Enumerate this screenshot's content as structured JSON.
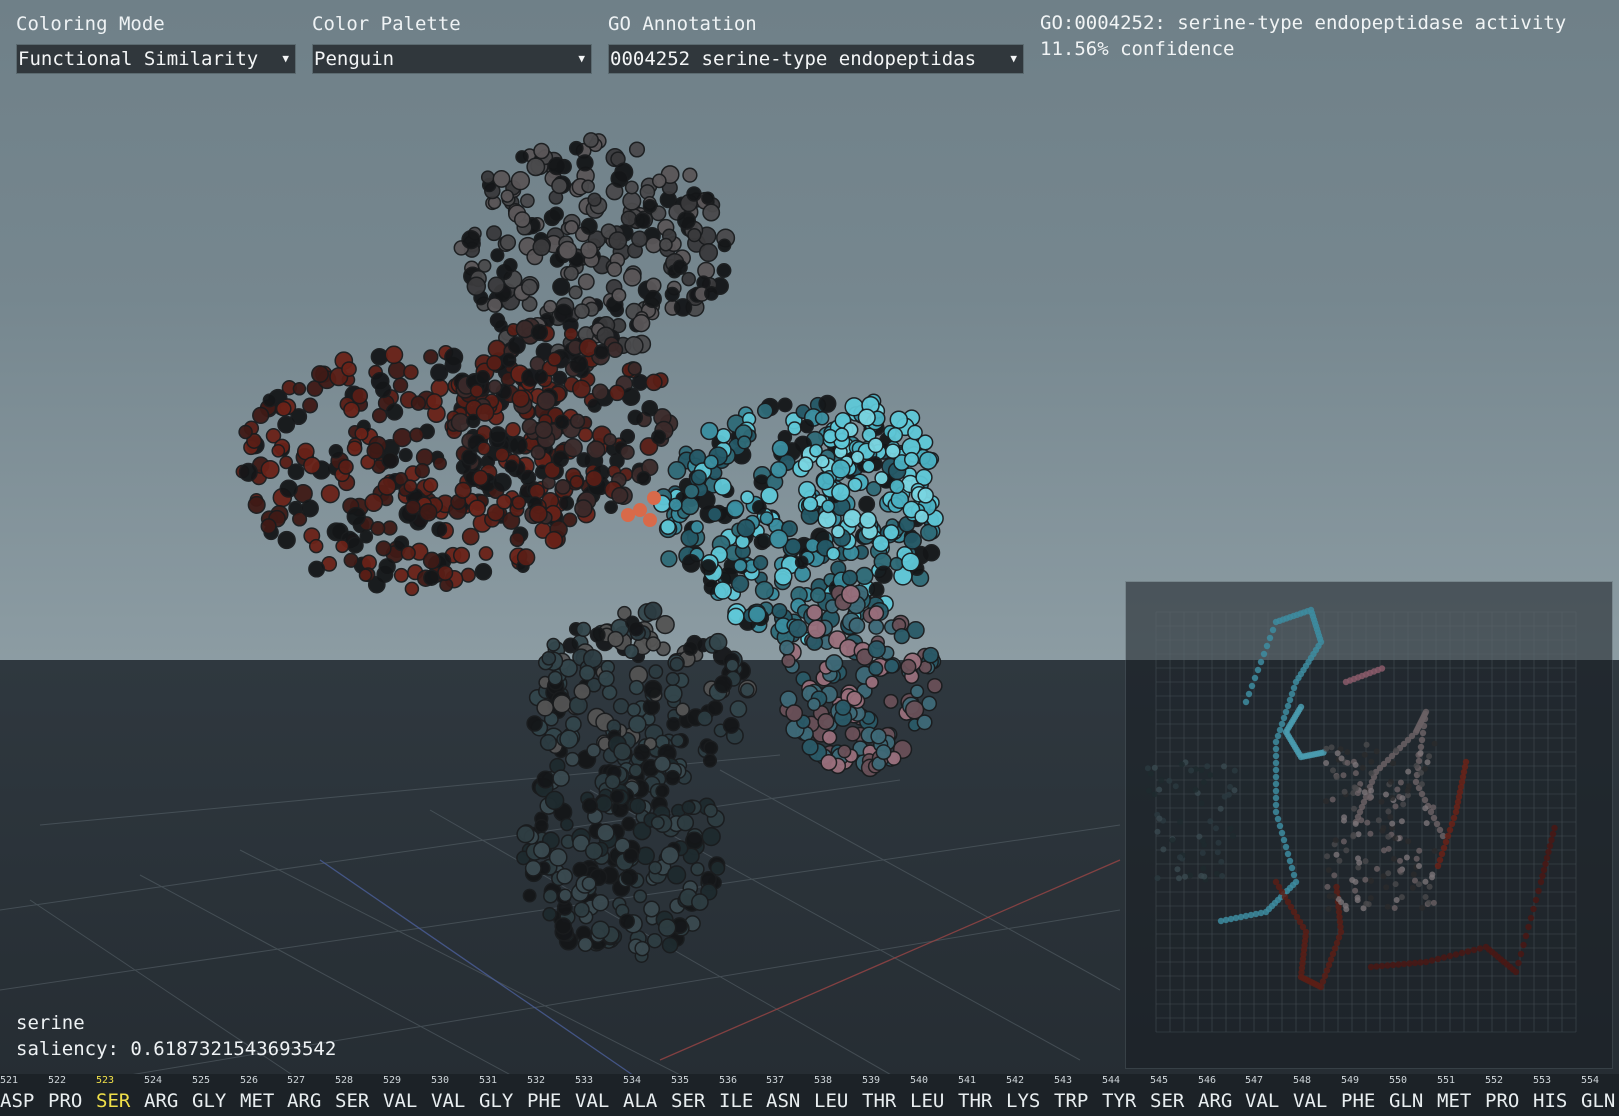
{
  "controls": {
    "coloring_mode": {
      "label": "Coloring Mode",
      "value": "Functional Similarity"
    },
    "color_palette": {
      "label": "Color Palette",
      "value": "Penguin"
    },
    "go_annotation": {
      "label": "GO Annotation",
      "value": "0004252 serine-type endopeptidas"
    }
  },
  "go_info": {
    "term": "GO:0004252: serine-type endopeptidase activity",
    "confidence": "11.56% confidence"
  },
  "hover": {
    "residue": "serine",
    "saliency": "saliency: 0.6187321543693542"
  },
  "sequence": {
    "highlight_index": 2,
    "highlight_color": "#f0e04a",
    "residues": [
      {
        "num": "521",
        "code": "ASP"
      },
      {
        "num": "522",
        "code": "PRO"
      },
      {
        "num": "523",
        "code": "SER"
      },
      {
        "num": "524",
        "code": "ARG"
      },
      {
        "num": "525",
        "code": "GLY"
      },
      {
        "num": "526",
        "code": "MET"
      },
      {
        "num": "527",
        "code": "ARG"
      },
      {
        "num": "528",
        "code": "SER"
      },
      {
        "num": "529",
        "code": "VAL"
      },
      {
        "num": "530",
        "code": "VAL"
      },
      {
        "num": "531",
        "code": "GLY"
      },
      {
        "num": "532",
        "code": "PHE"
      },
      {
        "num": "533",
        "code": "VAL"
      },
      {
        "num": "534",
        "code": "ALA"
      },
      {
        "num": "535",
        "code": "SER"
      },
      {
        "num": "536",
        "code": "ILE"
      },
      {
        "num": "537",
        "code": "ASN"
      },
      {
        "num": "538",
        "code": "LEU"
      },
      {
        "num": "539",
        "code": "THR"
      },
      {
        "num": "540",
        "code": "LEU"
      },
      {
        "num": "541",
        "code": "THR"
      },
      {
        "num": "542",
        "code": "LYS"
      },
      {
        "num": "543",
        "code": "TRP"
      },
      {
        "num": "544",
        "code": "TYR"
      },
      {
        "num": "545",
        "code": "SER"
      },
      {
        "num": "546",
        "code": "ARG"
      },
      {
        "num": "547",
        "code": "VAL"
      },
      {
        "num": "548",
        "code": "VAL"
      },
      {
        "num": "549",
        "code": "PHE"
      },
      {
        "num": "550",
        "code": "GLN"
      },
      {
        "num": "551",
        "code": "MET"
      },
      {
        "num": "552",
        "code": "PRO"
      },
      {
        "num": "553",
        "code": "HIS"
      },
      {
        "num": "554",
        "code": "GLN"
      }
    ]
  },
  "palette": {
    "red": "#5a1e16",
    "teal": "#2f6b78",
    "cyan": "#5fc8d8",
    "gray": "#4a4a4c",
    "dark": "#141618",
    "pink": "#9a6f7c",
    "orange": "#d86a4a"
  }
}
